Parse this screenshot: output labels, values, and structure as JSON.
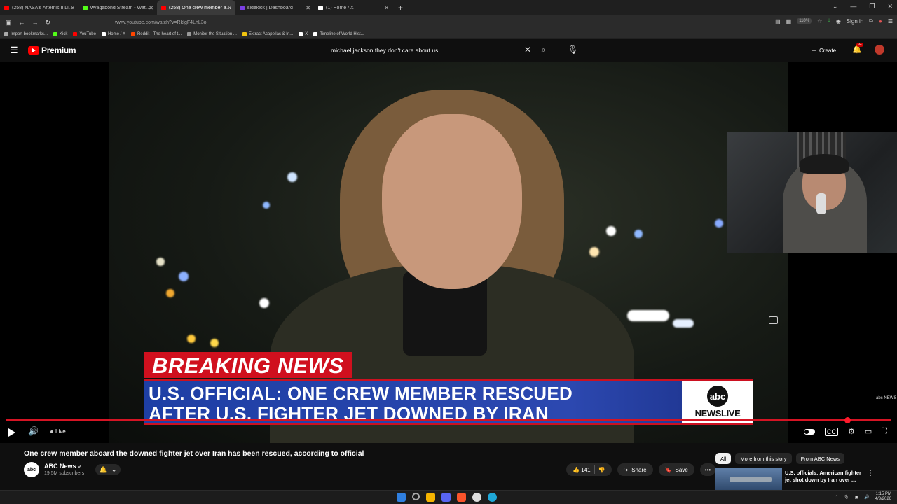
{
  "browser": {
    "tabs": [
      {
        "label": "(258) NASA's Artemis II Live Mi",
        "color": "#ff0000",
        "active": false
      },
      {
        "label": "wvagabond Stream - Watch Liv",
        "color": "#53fc18",
        "active": false
      },
      {
        "label": "(258) One crew member aboa",
        "color": "#ff0000",
        "active": true
      },
      {
        "label": "sidekick | Dashboard",
        "color": "#7b3fe4",
        "active": false
      },
      {
        "label": "(1) Home / X",
        "color": "#ffffff",
        "active": false
      }
    ],
    "new_tab": "+",
    "url": "www.youtube.com/watch?v=RkIgF4LhL3o",
    "zoom": "110%",
    "sign_in": "Sign in",
    "bookmarks": [
      {
        "label": "Import bookmarks...",
        "color": "#aaaaaa"
      },
      {
        "label": "Kick",
        "color": "#53fc18"
      },
      {
        "label": "YouTube",
        "color": "#ff0000"
      },
      {
        "label": "Home / X",
        "color": "#ffffff"
      },
      {
        "label": "Reddit - The heart of t...",
        "color": "#ff4500"
      },
      {
        "label": "Monitor the Situation ...",
        "color": "#999999"
      },
      {
        "label": "Extract Acapellas & In...",
        "color": "#f1c40f"
      },
      {
        "label": "X",
        "color": "#ffffff"
      },
      {
        "label": "Timeline of World Hist...",
        "color": "#ffffff"
      }
    ]
  },
  "youtube": {
    "logo_text": "Premium",
    "search_value": "michael jackson they don't care about us",
    "create_label": "Create",
    "notif_count": "9+"
  },
  "video": {
    "breaking": "BREAKING NEWS",
    "headline_1": "U.S. OFFICIAL: ONE CREW MEMBER RESCUED",
    "headline_2": "AFTER U.S. FIGHTER JET DOWNED BY IRAN",
    "network_logo": "abc",
    "network_live": "NEWSLIVE",
    "watermark": "abc NEWS",
    "live_label": "Live",
    "progress_fraction": 0.95
  },
  "info": {
    "title": "One crew member aboard the downed fighter jet over Iran has been rescued, according to official",
    "channel_name": "ABC News",
    "channel_avatar": "abc",
    "subscribers": "19.5M subscribers",
    "likes": "141",
    "share": "Share",
    "save": "Save"
  },
  "sidebar": {
    "chips": [
      "All",
      "More from this story",
      "From ABC News"
    ],
    "rec_title": "U.S. officials: American fighter jet shot down by Iran over ..."
  },
  "taskbar": {
    "time": "1:15 PM",
    "date": "4/3/2026",
    "apps": [
      {
        "name": "windows-start",
        "color": "#2f7fe0"
      },
      {
        "name": "search",
        "color": "#777777"
      },
      {
        "name": "file-explorer",
        "color": "#f5b400"
      },
      {
        "name": "discord",
        "color": "#5865f2"
      },
      {
        "name": "brave",
        "color": "#fb542b"
      },
      {
        "name": "chrome",
        "color": "#dddddd"
      },
      {
        "name": "edge",
        "color": "#1fa8d8"
      }
    ]
  }
}
